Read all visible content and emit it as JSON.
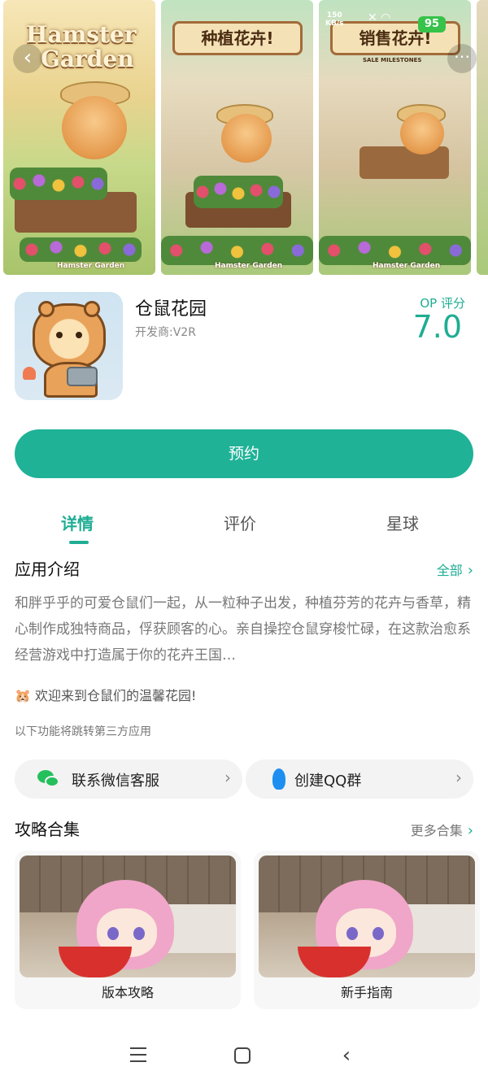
{
  "status_bar": {
    "speed": "150\nKB/s",
    "battery": "95"
  },
  "gallery": {
    "shots": [
      {
        "logo_line1": "Hamster",
        "logo_line2": "Garden",
        "mini_logo": "Hamster Garden"
      },
      {
        "banner": "种植花卉!",
        "mini_logo": "Hamster Garden"
      },
      {
        "banner": "销售花卉!",
        "sub_banner": "SALE MILESTONES",
        "mini_logo": "Hamster Garden"
      }
    ]
  },
  "app": {
    "name": "仓鼠花园",
    "developer": "开发商:V2R",
    "score_label": "OP 评分",
    "score": "7.0"
  },
  "actions": {
    "reserve": "预约"
  },
  "tabs": [
    {
      "label": "详情",
      "active": true
    },
    {
      "label": "评价",
      "active": false
    },
    {
      "label": "星球",
      "active": false
    }
  ],
  "intro": {
    "title": "应用介绍",
    "all_link": "全部",
    "text": "和胖乎乎的可爱仓鼠们一起，从一粒种子出发，种植芬芳的花卉与香草，精心制作成独特商品，俘获顾客的心。亲自操控仓鼠穿梭忙碌，在这款治愈系经营游戏中打造属于你的花卉王国…",
    "welcome": "🐹 欢迎来到仓鼠们的温馨花园!",
    "third_party_note": "以下功能将跳转第三方应用"
  },
  "third_party": [
    {
      "label": "联系微信客服",
      "icon": "wechat-icon"
    },
    {
      "label": "创建QQ群",
      "icon": "qq-icon"
    }
  ],
  "guides": {
    "title": "攻略合集",
    "more_link": "更多合集",
    "cards": [
      {
        "label": "版本攻略"
      },
      {
        "label": "新手指南"
      }
    ]
  },
  "colors": {
    "accent": "#1fb297",
    "accent_text": "#1fad93"
  }
}
